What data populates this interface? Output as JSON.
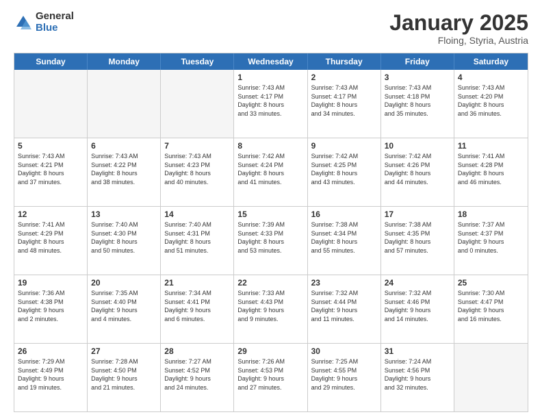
{
  "header": {
    "logo_general": "General",
    "logo_blue": "Blue",
    "title": "January 2025",
    "location": "Floing, Styria, Austria"
  },
  "weekdays": [
    "Sunday",
    "Monday",
    "Tuesday",
    "Wednesday",
    "Thursday",
    "Friday",
    "Saturday"
  ],
  "rows": [
    [
      {
        "day": "",
        "text": ""
      },
      {
        "day": "",
        "text": ""
      },
      {
        "day": "",
        "text": ""
      },
      {
        "day": "1",
        "text": "Sunrise: 7:43 AM\nSunset: 4:17 PM\nDaylight: 8 hours\nand 33 minutes."
      },
      {
        "day": "2",
        "text": "Sunrise: 7:43 AM\nSunset: 4:17 PM\nDaylight: 8 hours\nand 34 minutes."
      },
      {
        "day": "3",
        "text": "Sunrise: 7:43 AM\nSunset: 4:18 PM\nDaylight: 8 hours\nand 35 minutes."
      },
      {
        "day": "4",
        "text": "Sunrise: 7:43 AM\nSunset: 4:20 PM\nDaylight: 8 hours\nand 36 minutes."
      }
    ],
    [
      {
        "day": "5",
        "text": "Sunrise: 7:43 AM\nSunset: 4:21 PM\nDaylight: 8 hours\nand 37 minutes."
      },
      {
        "day": "6",
        "text": "Sunrise: 7:43 AM\nSunset: 4:22 PM\nDaylight: 8 hours\nand 38 minutes."
      },
      {
        "day": "7",
        "text": "Sunrise: 7:43 AM\nSunset: 4:23 PM\nDaylight: 8 hours\nand 40 minutes."
      },
      {
        "day": "8",
        "text": "Sunrise: 7:42 AM\nSunset: 4:24 PM\nDaylight: 8 hours\nand 41 minutes."
      },
      {
        "day": "9",
        "text": "Sunrise: 7:42 AM\nSunset: 4:25 PM\nDaylight: 8 hours\nand 43 minutes."
      },
      {
        "day": "10",
        "text": "Sunrise: 7:42 AM\nSunset: 4:26 PM\nDaylight: 8 hours\nand 44 minutes."
      },
      {
        "day": "11",
        "text": "Sunrise: 7:41 AM\nSunset: 4:28 PM\nDaylight: 8 hours\nand 46 minutes."
      }
    ],
    [
      {
        "day": "12",
        "text": "Sunrise: 7:41 AM\nSunset: 4:29 PM\nDaylight: 8 hours\nand 48 minutes."
      },
      {
        "day": "13",
        "text": "Sunrise: 7:40 AM\nSunset: 4:30 PM\nDaylight: 8 hours\nand 50 minutes."
      },
      {
        "day": "14",
        "text": "Sunrise: 7:40 AM\nSunset: 4:31 PM\nDaylight: 8 hours\nand 51 minutes."
      },
      {
        "day": "15",
        "text": "Sunrise: 7:39 AM\nSunset: 4:33 PM\nDaylight: 8 hours\nand 53 minutes."
      },
      {
        "day": "16",
        "text": "Sunrise: 7:38 AM\nSunset: 4:34 PM\nDaylight: 8 hours\nand 55 minutes."
      },
      {
        "day": "17",
        "text": "Sunrise: 7:38 AM\nSunset: 4:35 PM\nDaylight: 8 hours\nand 57 minutes."
      },
      {
        "day": "18",
        "text": "Sunrise: 7:37 AM\nSunset: 4:37 PM\nDaylight: 9 hours\nand 0 minutes."
      }
    ],
    [
      {
        "day": "19",
        "text": "Sunrise: 7:36 AM\nSunset: 4:38 PM\nDaylight: 9 hours\nand 2 minutes."
      },
      {
        "day": "20",
        "text": "Sunrise: 7:35 AM\nSunset: 4:40 PM\nDaylight: 9 hours\nand 4 minutes."
      },
      {
        "day": "21",
        "text": "Sunrise: 7:34 AM\nSunset: 4:41 PM\nDaylight: 9 hours\nand 6 minutes."
      },
      {
        "day": "22",
        "text": "Sunrise: 7:33 AM\nSunset: 4:43 PM\nDaylight: 9 hours\nand 9 minutes."
      },
      {
        "day": "23",
        "text": "Sunrise: 7:32 AM\nSunset: 4:44 PM\nDaylight: 9 hours\nand 11 minutes."
      },
      {
        "day": "24",
        "text": "Sunrise: 7:32 AM\nSunset: 4:46 PM\nDaylight: 9 hours\nand 14 minutes."
      },
      {
        "day": "25",
        "text": "Sunrise: 7:30 AM\nSunset: 4:47 PM\nDaylight: 9 hours\nand 16 minutes."
      }
    ],
    [
      {
        "day": "26",
        "text": "Sunrise: 7:29 AM\nSunset: 4:49 PM\nDaylight: 9 hours\nand 19 minutes."
      },
      {
        "day": "27",
        "text": "Sunrise: 7:28 AM\nSunset: 4:50 PM\nDaylight: 9 hours\nand 21 minutes."
      },
      {
        "day": "28",
        "text": "Sunrise: 7:27 AM\nSunset: 4:52 PM\nDaylight: 9 hours\nand 24 minutes."
      },
      {
        "day": "29",
        "text": "Sunrise: 7:26 AM\nSunset: 4:53 PM\nDaylight: 9 hours\nand 27 minutes."
      },
      {
        "day": "30",
        "text": "Sunrise: 7:25 AM\nSunset: 4:55 PM\nDaylight: 9 hours\nand 29 minutes."
      },
      {
        "day": "31",
        "text": "Sunrise: 7:24 AM\nSunset: 4:56 PM\nDaylight: 9 hours\nand 32 minutes."
      },
      {
        "day": "",
        "text": ""
      }
    ]
  ]
}
